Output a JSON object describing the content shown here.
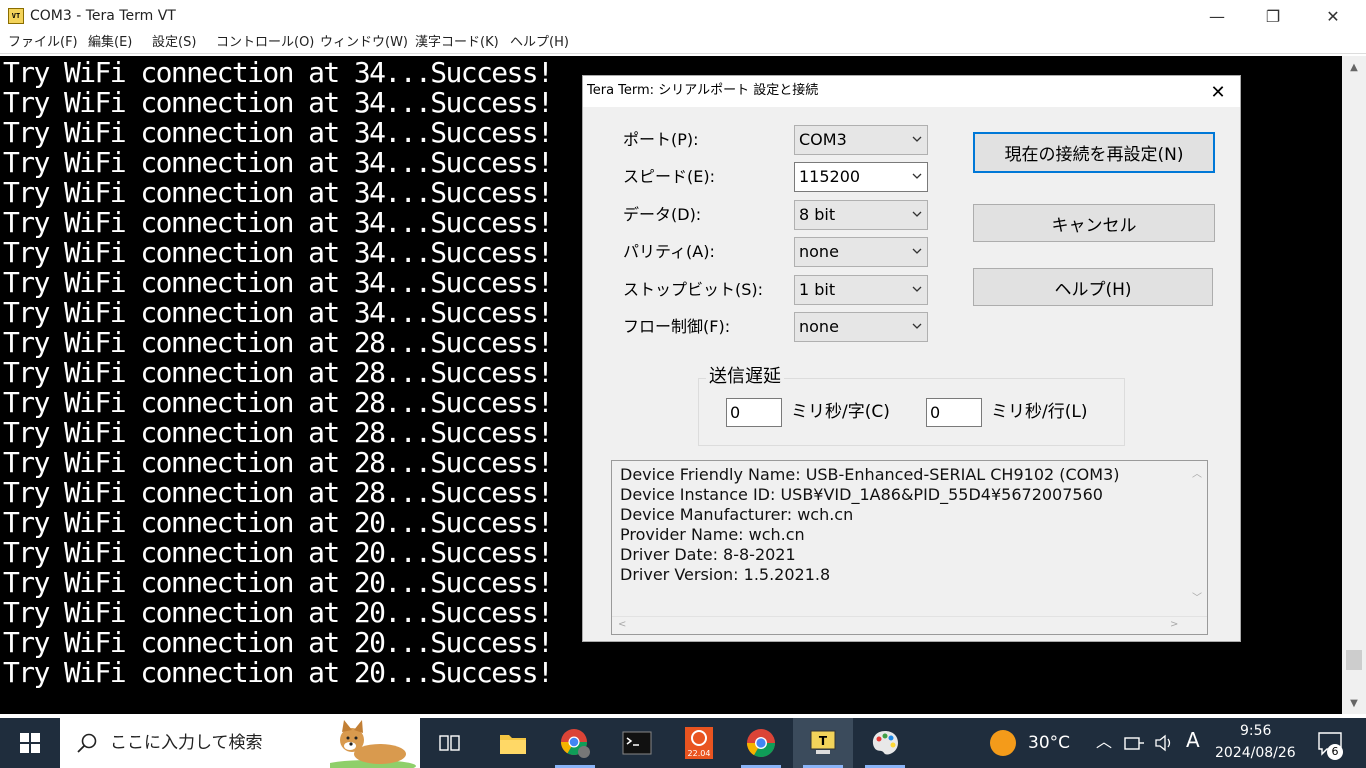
{
  "window": {
    "title": "COM3 - Tera Term VT",
    "icon_label": "VT",
    "controls": {
      "minimize": "—",
      "maximize": "❐",
      "close": "✕"
    }
  },
  "menu": {
    "items": [
      "ファイル(F)",
      "編集(E)",
      "設定(S)",
      "コントロール(O)",
      "ウィンドウ(W)",
      "漢字コード(K)",
      "ヘルプ(H)"
    ]
  },
  "terminal": {
    "lines": [
      "Try WiFi connection at 34...Success!",
      "Try WiFi connection at 34...Success!",
      "Try WiFi connection at 34...Success!",
      "Try WiFi connection at 34...Success!",
      "Try WiFi connection at 34...Success!",
      "Try WiFi connection at 34...Success!",
      "Try WiFi connection at 34...Success!",
      "Try WiFi connection at 34...Success!",
      "Try WiFi connection at 34...Success!",
      "Try WiFi connection at 28...Success!",
      "Try WiFi connection at 28...Success!",
      "Try WiFi connection at 28...Success!",
      "Try WiFi connection at 28...Success!",
      "Try WiFi connection at 28...Success!",
      "Try WiFi connection at 28...Success!",
      "Try WiFi connection at 20...Success!",
      "Try WiFi connection at 20...Success!",
      "Try WiFi connection at 20...Success!",
      "Try WiFi connection at 20...Success!",
      "Try WiFi connection at 20...Success!",
      "Try WiFi connection at 20...Success!"
    ],
    "bg_color": "#000000",
    "fg_color": "#ffffff"
  },
  "dialog": {
    "title": "Tera Term: シリアルポート 設定と接続",
    "close": "✕",
    "fields": [
      {
        "label": "ポート(P):",
        "value": "COM3"
      },
      {
        "label": "スピード(E):",
        "value": "115200"
      },
      {
        "label": "データ(D):",
        "value": "8 bit"
      },
      {
        "label": "パリティ(A):",
        "value": "none"
      },
      {
        "label": "ストップビット(S):",
        "value": "1 bit"
      },
      {
        "label": "フロー制御(F):",
        "value": "none"
      }
    ],
    "buttons": {
      "reset": "現在の接続を再設定(N)",
      "cancel": "キャンセル",
      "help": "ヘルプ(H)"
    },
    "delay": {
      "legend": "送信遅延",
      "char_value": "0",
      "char_unit": "ミリ秒/字(C)",
      "line_value": "0",
      "line_unit": "ミリ秒/行(L)"
    },
    "info": [
      "Device Friendly Name: USB-Enhanced-SERIAL CH9102 (COM3)",
      "Device Instance ID: USB¥VID_1A86&PID_55D4¥5672007560",
      "Device Manufacturer: wch.cn",
      "Provider Name: wch.cn",
      "Driver Date: 8-8-2021",
      "Driver Version: 1.5.2021.8"
    ]
  },
  "taskbar": {
    "search_placeholder": "ここに入力して検索",
    "apps": [
      "task-view",
      "file-explorer",
      "chrome-profile",
      "terminal",
      "ubuntu",
      "chrome",
      "tera-term",
      "paint"
    ],
    "ubuntu_label": "22.04",
    "weather": "30°C",
    "ime": "A",
    "time": "9:56",
    "date": "2024/08/26",
    "notifications": "6",
    "bg_color": "#1f2d3d"
  }
}
